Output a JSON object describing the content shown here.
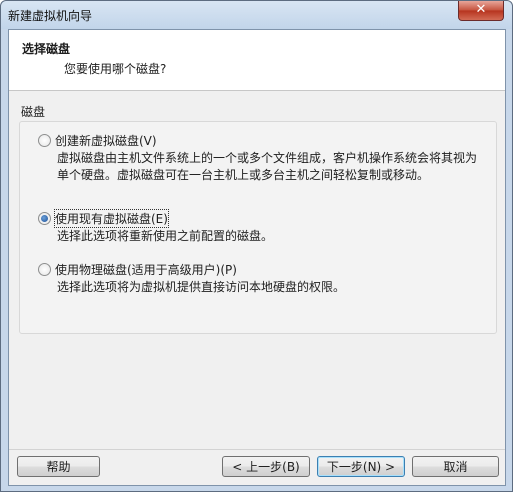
{
  "window": {
    "title": "新建虚拟机向导",
    "close_label": "✕"
  },
  "header": {
    "title": "选择磁盘",
    "subtitle": "您要使用哪个磁盘?"
  },
  "group": {
    "label": "磁盘"
  },
  "options": [
    {
      "label": "创建新虚拟磁盘(V)",
      "description": "虚拟磁盘由主机文件系统上的一个或多个文件组成，客户机操作系统会将其视为单个硬盘。虚拟磁盘可在一台主机上或多台主机之间轻松复制或移动。",
      "checked": false
    },
    {
      "label": "使用现有虚拟磁盘(E)",
      "description": "选择此选项将重新使用之前配置的磁盘。",
      "checked": true
    },
    {
      "label": "使用物理磁盘(适用于高级用户)(P)",
      "description": "选择此选项将为虚拟机提供直接访问本地硬盘的权限。",
      "checked": false
    }
  ],
  "buttons": {
    "help": "帮助",
    "back": "< 上一步(B)",
    "next": "下一步(N) >",
    "cancel": "取消"
  }
}
